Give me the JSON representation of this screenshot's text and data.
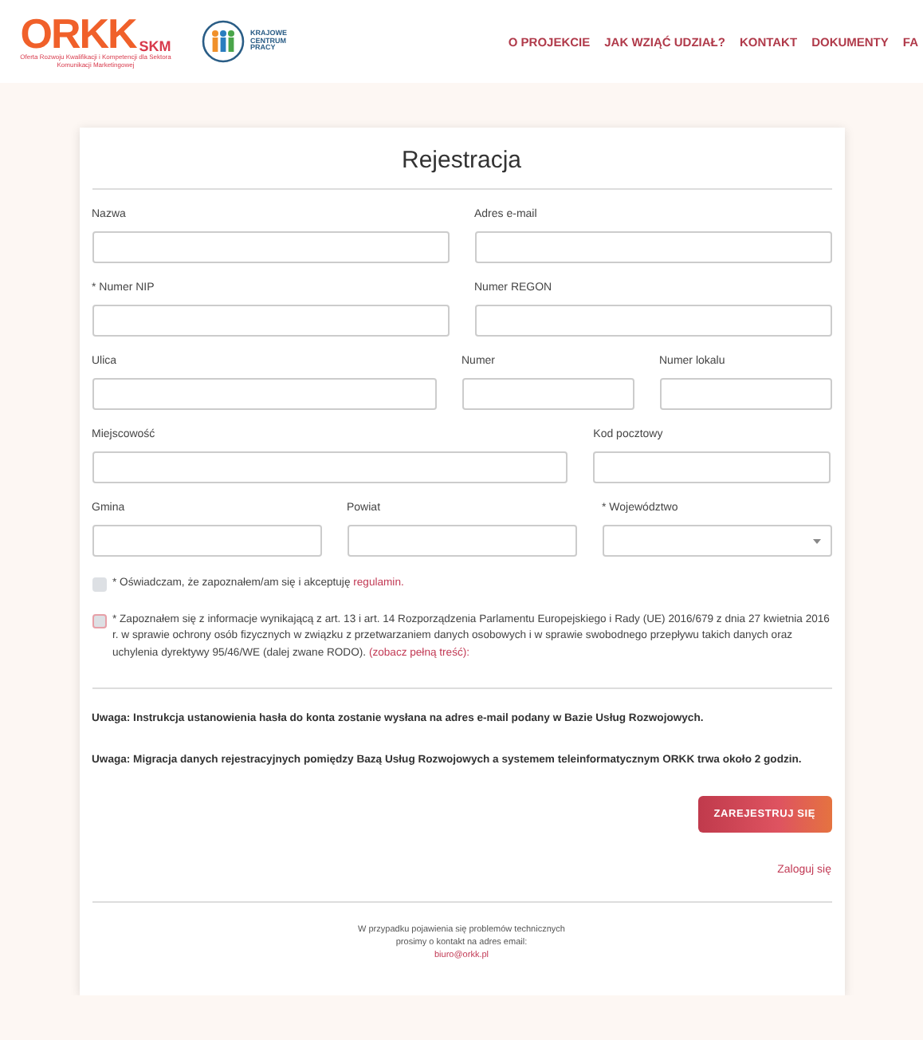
{
  "header": {
    "logo": {
      "name": "ORKK",
      "suffix": "SKM",
      "tagline": "Oferta Rozwoju Kwalifikacji i Kompetencji dla Sektora Komunikacji Marketingowej"
    },
    "partner_logo": {
      "lines": [
        "KRAJOWE",
        "CENTRUM",
        "PRACY"
      ]
    },
    "nav": [
      "O PROJEKCIE",
      "JAK WZIĄĆ UDZIAŁ?",
      "KONTAKT",
      "DOKUMENTY",
      "FA"
    ]
  },
  "form": {
    "title": "Rejestracja",
    "rows": [
      [
        {
          "label": "Nazwa",
          "kind": "text"
        },
        {
          "label": "Adres e-mail",
          "kind": "text"
        }
      ],
      [
        {
          "label": "* Numer NIP",
          "kind": "text"
        },
        {
          "label": "Numer REGON",
          "kind": "text"
        }
      ],
      [
        {
          "label": "Ulica",
          "kind": "text"
        },
        {
          "label": "Numer",
          "kind": "text"
        },
        {
          "label": "Numer lokalu",
          "kind": "text"
        }
      ],
      [
        {
          "label": "Miejscowość",
          "kind": "text"
        },
        {
          "label": "Kod pocztowy",
          "kind": "text"
        }
      ],
      [
        {
          "label": "Gmina",
          "kind": "text"
        },
        {
          "label": "Powiat",
          "kind": "text"
        },
        {
          "label": "* Województwo",
          "kind": "select"
        }
      ]
    ],
    "consents": [
      {
        "text": "* Oświadczam, że zapoznałem/am się i akceptuję",
        "link": "regulamin.",
        "checked": false,
        "invalid": false
      },
      {
        "text": "* Zapoznałem się z informacje wynikającą z art. 13 i art. 14 Rozporządzenia Parlamentu Europejskiego i Rady (UE) 2016/679 z dnia 27 kwietnia 2016 r. w sprawie ochrony osób fizycznych w związku z przetwarzaniem danych osobowych i w sprawie swobodnego przepływu takich danych oraz uchylenia dyrektywy 95/46/WE (dalej zwane RODO).",
        "link": "(zobacz pełną treść):",
        "checked": false,
        "invalid": true
      }
    ],
    "notes": [
      "Uwaga: Instrukcja ustanowienia hasła do konta zostanie wysłana na adres e-mail podany w Bazie Usług Rozwojowych.",
      "Uwaga: Migracja danych rejestracyjnych pomiędzy Bazą Usług Rozwojowych a systemem teleinformatycznym ORKK trwa około 2 godzin."
    ],
    "submit": "ZAREJESTRUJ SIĘ",
    "login_link": "Zaloguj się",
    "footer": {
      "lines": [
        "W przypadku pojawienia się problemów technicznych",
        "prosimy o kontakt na adres email:"
      ],
      "email": "biuro@orkk.pl"
    }
  }
}
